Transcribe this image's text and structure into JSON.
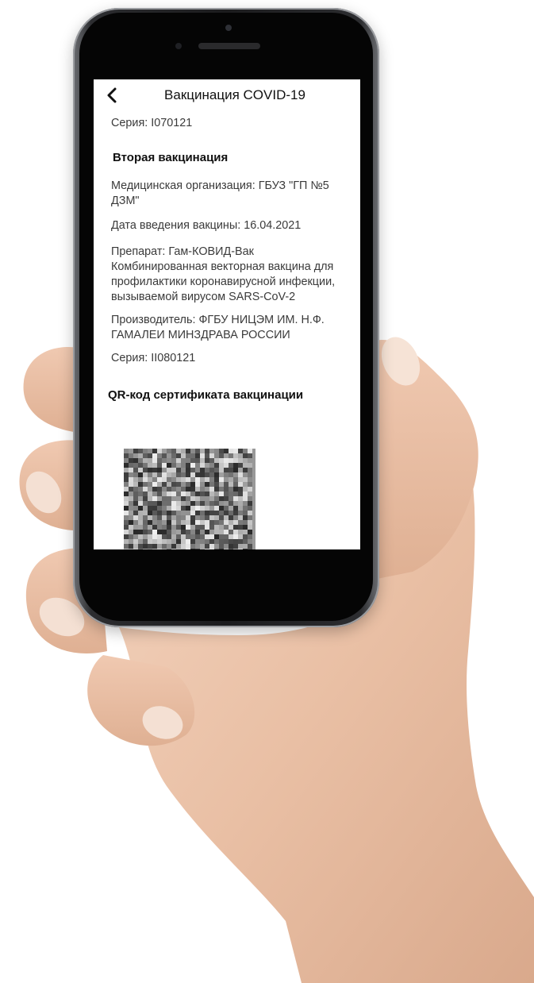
{
  "app": {
    "title": "Вакцинация COVID-19",
    "back_icon": "chevron-left-icon"
  },
  "first_vaccination": {
    "series": "Серия: I070121"
  },
  "second_vaccination": {
    "heading": "Вторая вакцинация",
    "organization": [
      "Медицинская организация: ГБУЗ \"ГП №5",
      "ДЗМ\""
    ],
    "date": "Дата введения вакцины: 16.04.2021",
    "drug": [
      "Препарат: Гам-КОВИД-Вак",
      "Комбинированная векторная вакцина для",
      "профилактики коронавирусной инфекции,",
      "вызываемой вирусом SARS-CoV-2"
    ],
    "manufacturer": [
      "Производитель: ФГБУ НИЦЭМ ИМ. Н.Ф.",
      "ГАМАЛЕИ МИНЗДРАВА РОССИИ"
    ],
    "series": "Серия: II080121"
  },
  "qr_section": {
    "heading": "QR-код сертификата вакцинации",
    "image_icon": "qr-code-image"
  },
  "colors": {
    "screen_bg": "#ffffff",
    "text": "#3a3a3a",
    "heading": "#111111",
    "phone_frame": "#1c1c1e"
  }
}
